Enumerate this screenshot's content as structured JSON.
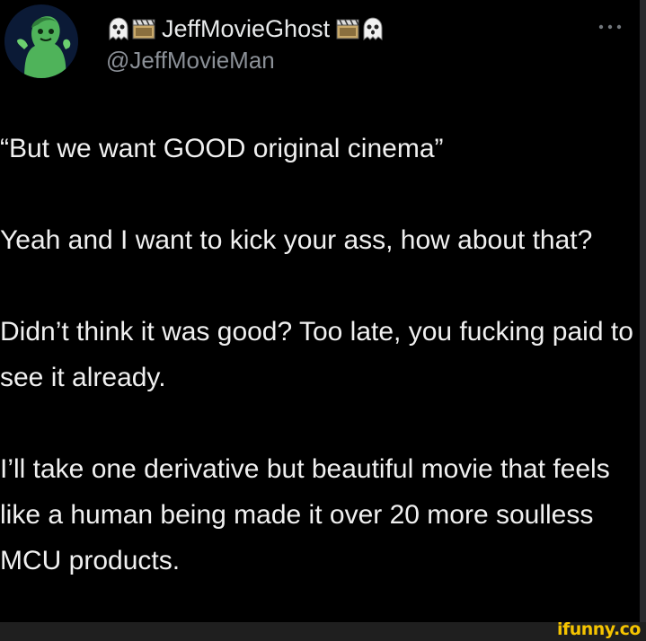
{
  "user": {
    "display_name": "JeffMovieGhost",
    "handle": "@JeffMovieMan",
    "name_decorations": [
      "ghost-emoji",
      "film-clapper-emoji",
      "film-clapper-emoji",
      "ghost-emoji"
    ],
    "avatar": "green-ghost-avatar"
  },
  "menu": {
    "icon": "more-options-icon"
  },
  "tweet": {
    "paragraphs": [
      "“But we want GOOD original cinema”",
      "Yeah and I want to kick your ass, how about that?",
      "Didn’t think it was good? Too late, you fucking paid to see it already.",
      "I’ll take one derivative but beautiful movie that feels like a human being made it over 20 more soulless MCU products."
    ]
  },
  "watermark": {
    "text": "ifunny.co"
  },
  "colors": {
    "background": "#000000",
    "text": "#e7e9ea",
    "handle": "#8b9097",
    "watermark": "#f5c400"
  }
}
